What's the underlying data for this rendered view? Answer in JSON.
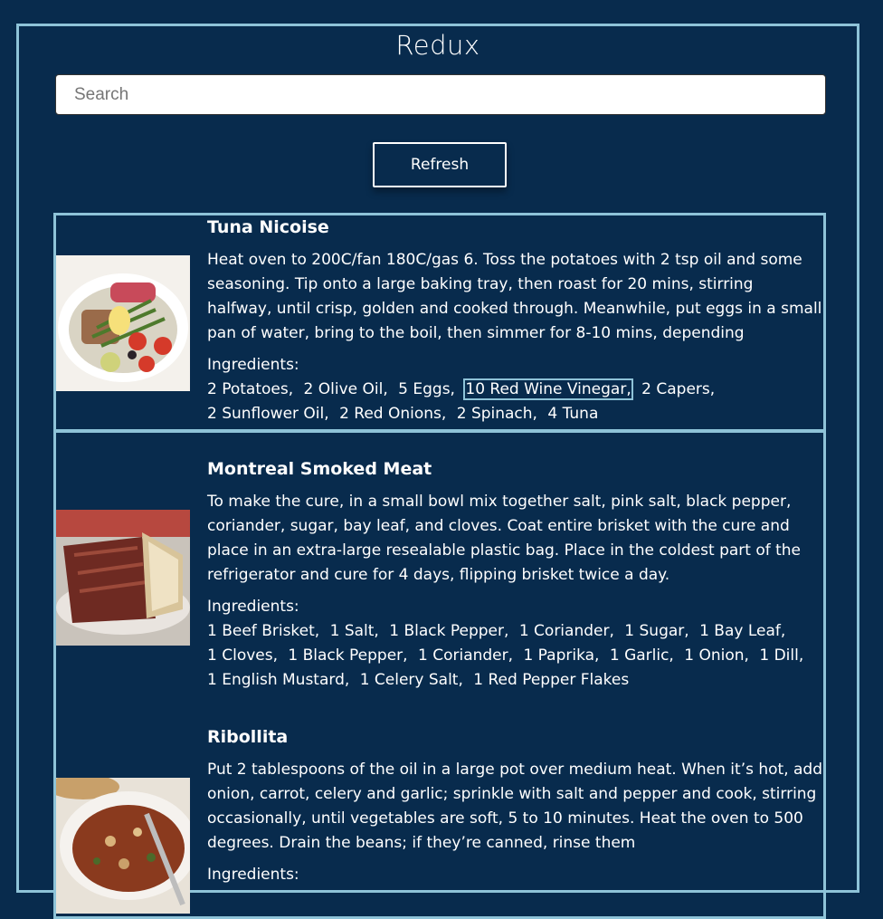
{
  "app": {
    "title": "Redux"
  },
  "search": {
    "placeholder": "Search",
    "value": ""
  },
  "refresh": {
    "label": "Refresh"
  },
  "recipes": [
    {
      "name": "Tuna Nicoise",
      "image": "tuna-nicoise-photo",
      "description": "Heat oven to 200C/fan 180C/gas 6. Toss the potatoes with 2 tsp oil and some seasoning. Tip onto a large baking tray, then roast for 20 mins, stirring halfway, until crisp, golden and cooked through. Meanwhile, put eggs in a small pan of water, bring to the boil, then simmer for 8-10 mins, depending",
      "ingredients_label": "Ingredients:",
      "ingredients": [
        "2 Potatoes,",
        "2 Olive Oil,",
        "5 Eggs,",
        "10 Red Wine Vinegar,",
        "2 Capers,",
        "2 Sunflower Oil,",
        "2 Red Onions,",
        "2 Spinach,",
        "4 Tuna"
      ],
      "selected_ingredient": "10 Red Wine Vinegar,"
    },
    {
      "name": "Montreal Smoked Meat",
      "image": "smoked-meat-sandwich-photo",
      "description": "To make the cure, in a small bowl mix together salt, pink salt, black pepper, coriander, sugar, bay leaf, and cloves. Coat entire brisket with the cure and place in an extra-large resealable plastic bag. Place in the coldest part of the refrigerator and cure for 4 days, flipping brisket twice a day.",
      "ingredients_label": "Ingredients:",
      "ingredients": [
        "1 Beef Brisket,",
        "1 Salt,",
        "1 Black Pepper,",
        "1 Coriander,",
        "1 Sugar,",
        "1 Bay Leaf,",
        "1 Cloves,",
        "1 Black Pepper,",
        "1 Coriander,",
        "1 Paprika,",
        "1 Garlic,",
        "1 Onion,",
        "1 Dill,",
        "1 English Mustard,",
        "1 Celery Salt,",
        "1 Red Pepper Flakes"
      ]
    },
    {
      "name": "Ribollita",
      "image": "ribollita-soup-photo",
      "description": "Put 2 tablespoons of the oil in a large pot over medium heat. When it’s hot, add onion, carrot, celery and garlic; sprinkle with salt and pepper and cook, stirring occasionally, until vegetables are soft, 5 to 10 minutes. Heat the oven to 500 degrees. Drain the beans; if they’re canned, rinse them",
      "ingredients_label": "Ingredients:"
    }
  ],
  "colors": {
    "background": "#082b4d",
    "border": "#8ec3d8",
    "text": "#ffffff"
  }
}
